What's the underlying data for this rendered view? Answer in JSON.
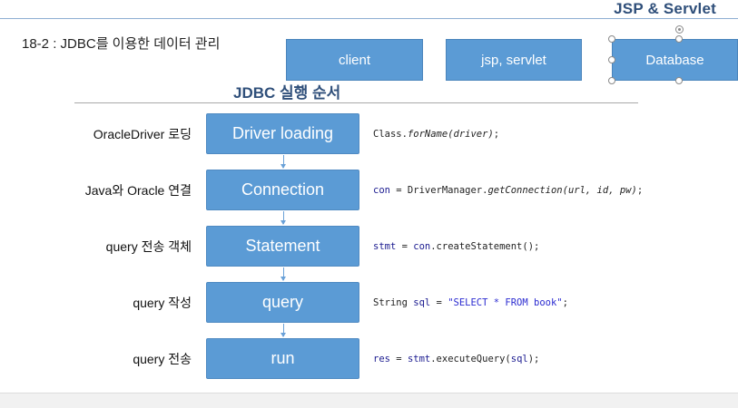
{
  "header": {
    "brand": "JSP & Servlet",
    "slide_title": "18-2 : JDBC를 이용한 데이터 관리"
  },
  "architecture": {
    "client": "client",
    "server": "jsp, servlet",
    "database": "Database"
  },
  "section": {
    "heading": "JDBC 실행 순서"
  },
  "steps": [
    {
      "label": "OracleDriver 로딩",
      "box": "Driver loading",
      "code": [
        {
          "text": "Class.",
          "style": ""
        },
        {
          "text": "forName(driver)",
          "style": "italic"
        },
        {
          "text": ";",
          "style": ""
        }
      ]
    },
    {
      "label": "Java와 Oracle 연결",
      "box": "Connection",
      "code": [
        {
          "text": "con",
          "style": "kw"
        },
        {
          "text": " = DriverManager.",
          "style": ""
        },
        {
          "text": "getConnection(url, id, pw)",
          "style": "italic"
        },
        {
          "text": ";",
          "style": ""
        }
      ]
    },
    {
      "label": "query 전송 객체",
      "box": "Statement",
      "code": [
        {
          "text": "stmt",
          "style": "kw"
        },
        {
          "text": " = ",
          "style": ""
        },
        {
          "text": "con",
          "style": "kw"
        },
        {
          "text": ".createStatement();",
          "style": ""
        }
      ]
    },
    {
      "label": "query 작성",
      "box": "query",
      "code": [
        {
          "text": "String ",
          "style": ""
        },
        {
          "text": "sql",
          "style": "kw"
        },
        {
          "text": " = ",
          "style": ""
        },
        {
          "text": "\"SELECT * FROM book\"",
          "style": "str"
        },
        {
          "text": ";",
          "style": ""
        }
      ]
    },
    {
      "label": "query 전송",
      "box": "run",
      "code": [
        {
          "text": "res",
          "style": "kw"
        },
        {
          "text": " = ",
          "style": ""
        },
        {
          "text": "stmt",
          "style": "kw"
        },
        {
          "text": ".executeQuery(",
          "style": ""
        },
        {
          "text": "sql",
          "style": "kw"
        },
        {
          "text": ");",
          "style": ""
        }
      ]
    }
  ],
  "colors": {
    "box_fill": "#5b9bd5",
    "heading": "#2f4f7a",
    "arrow": "#6aa1d8"
  }
}
